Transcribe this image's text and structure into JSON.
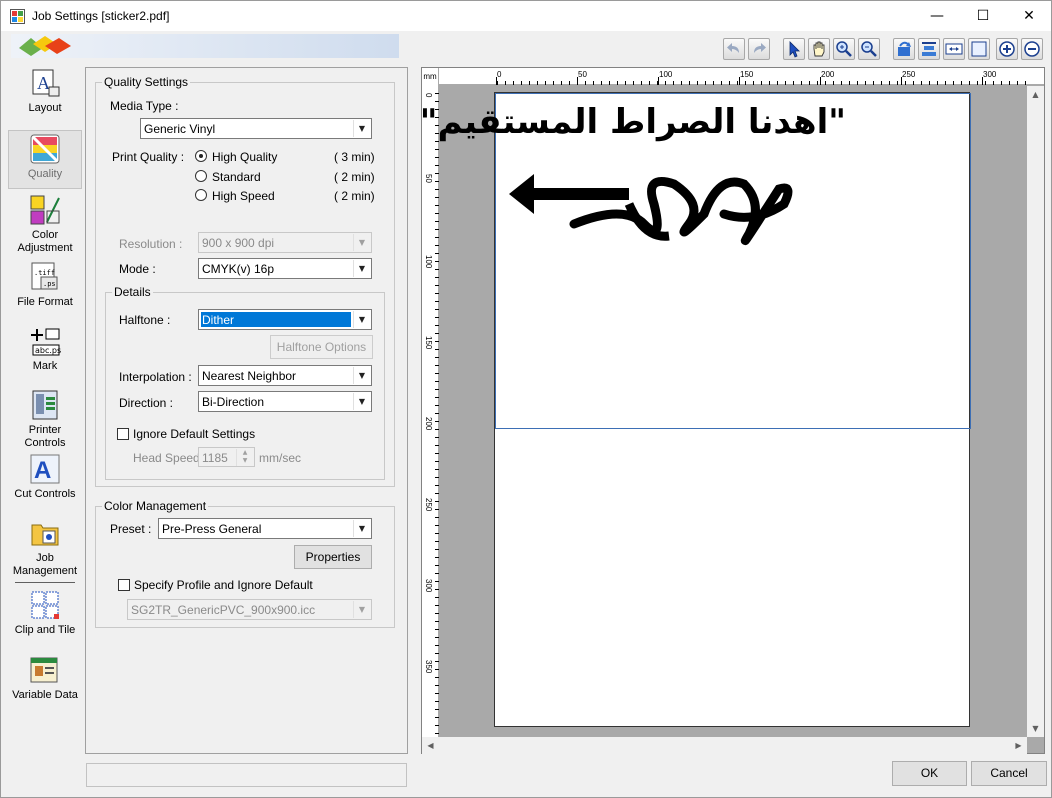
{
  "window": {
    "title": "Job Settings [sticker2.pdf]",
    "minimize": "—",
    "maximize": "☐",
    "close": "✕"
  },
  "toolbar": {
    "icons": [
      "undo-icon",
      "redo-icon",
      "pointer-icon",
      "hand-icon",
      "zoom-in-magnifier-icon",
      "zoom-out-magnifier-icon",
      "rotate-icon",
      "align-top-icon",
      "fit-width-icon",
      "fit-page-icon",
      "zoom-plus-icon",
      "zoom-minus-icon"
    ]
  },
  "nav": [
    {
      "label": "Layout",
      "icon": "layout-icon"
    },
    {
      "label": "Quality",
      "icon": "quality-icon",
      "selected": true
    },
    {
      "label": "Color Adjustment",
      "icon": "color-adjustment-icon"
    },
    {
      "label": "File Format",
      "icon": "file-format-icon"
    },
    {
      "label": "Mark",
      "icon": "mark-icon"
    },
    {
      "label": "Printer Controls",
      "icon": "printer-controls-icon"
    },
    {
      "label": "Cut Controls",
      "icon": "cut-controls-icon"
    },
    {
      "label": "Job Management",
      "icon": "job-management-icon"
    },
    {
      "label": "Clip and Tile",
      "icon": "clip-tile-icon"
    },
    {
      "label": "Variable Data",
      "icon": "variable-data-icon"
    }
  ],
  "quality": {
    "group_title": "Quality Settings",
    "media_type_label": "Media Type :",
    "media_type_value": "Generic Vinyl",
    "print_quality_label": "Print Quality :",
    "options": [
      {
        "label": "High Quality",
        "time": "( 3 min)",
        "checked": true
      },
      {
        "label": "Standard",
        "time": "( 2 min)",
        "checked": false
      },
      {
        "label": "High Speed",
        "time": "( 2 min)",
        "checked": false
      }
    ],
    "resolution_label": "Resolution :",
    "resolution_value": "900 x 900 dpi",
    "mode_label": "Mode :",
    "mode_value": "CMYK(v) 16p",
    "details": {
      "group_title": "Details",
      "halftone_label": "Halftone :",
      "halftone_value": "Dither",
      "halftone_options_button": "Halftone Options",
      "interpolation_label": "Interpolation :",
      "interpolation_value": "Nearest Neighbor",
      "direction_label": "Direction :",
      "direction_value": "Bi-Direction",
      "ignore_default_label": "Ignore Default Settings",
      "head_speed_label": "Head Speed",
      "head_speed_value": "1185",
      "head_speed_unit": "mm/sec"
    }
  },
  "color_management": {
    "group_title": "Color Management",
    "preset_label": "Preset :",
    "preset_value": "Pre-Press General",
    "properties_button": "Properties",
    "specify_profile_label": "Specify Profile and Ignore Default",
    "profile_value": "SG2TR_GenericPVC_900x900.icc"
  },
  "preview": {
    "unit": "mm",
    "h_ticks": [
      "0",
      "50",
      "100",
      "150",
      "200",
      "250",
      "300"
    ],
    "v_ticks": [
      "0",
      "50",
      "100",
      "150",
      "200",
      "250",
      "300",
      "350"
    ],
    "artwork_text": "\"اهدنا الصراط المستقيم\""
  },
  "footer": {
    "ok": "OK",
    "cancel": "Cancel"
  }
}
